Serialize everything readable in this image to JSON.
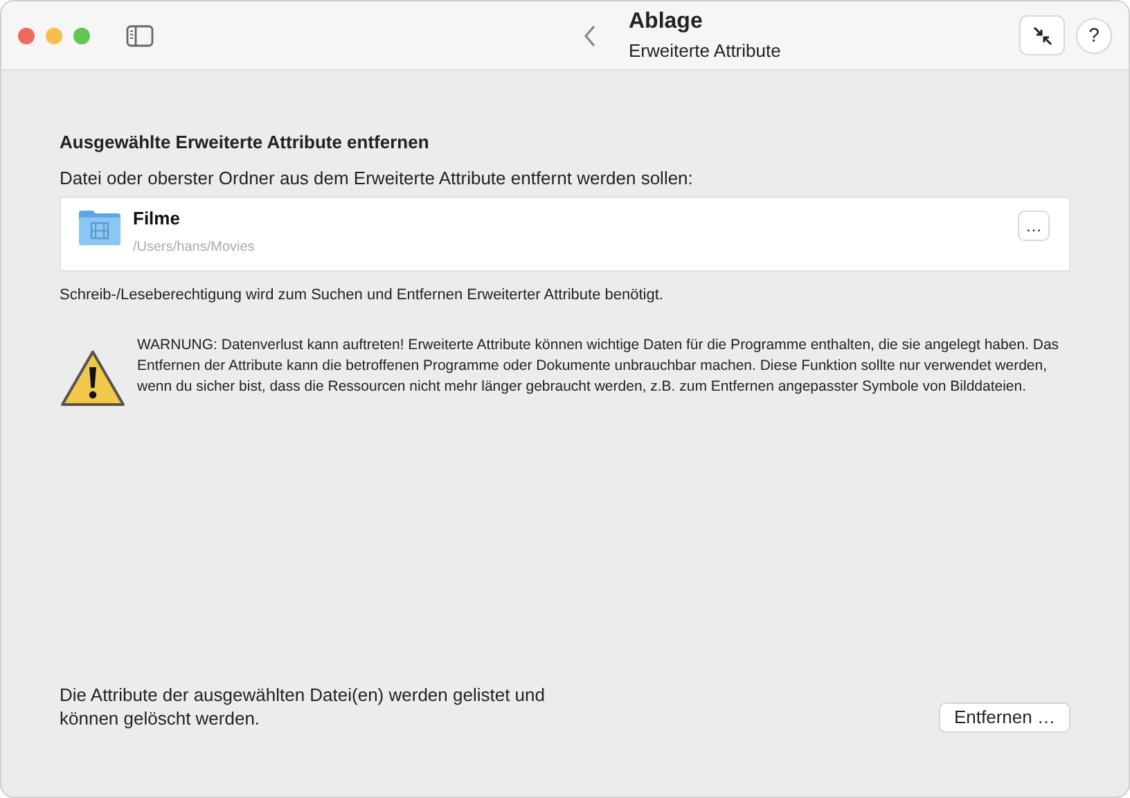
{
  "window": {
    "title": "Ablage",
    "subtitle": "Erweiterte Attribute"
  },
  "section_title": "Ausgewählte Erweiterte Attribute entfernen",
  "prompt": "Datei oder oberster Ordner aus dem Erweiterte Attribute entfernt werden sollen:",
  "selected_item": {
    "name": "Filme",
    "path": "/Users/hans/Movies",
    "browse_button": "…"
  },
  "permission_note": "Schreib-/Leseberechtigung wird zum Suchen und Entfernen Erweiterter Attribute benötigt.",
  "warning": "WARNUNG: Datenverlust kann auftreten! Erweiterte Attribute können wichtige Daten für die Programme enthalten, die sie angelegt haben. Das Entfernen der Attribute kann die betroffenen Programme oder Dokumente unbrauchbar machen. Diese Funktion sollte nur verwendet werden, wenn du sicher bist, dass die Ressourcen nicht mehr länger gebraucht werden, z.B. zum Entfernen angepasster Symbole von Bilddateien.",
  "footer_note": "Die Attribute der ausgewählten Datei(en) werden gelistet und können gelöscht werden.",
  "remove_button": "Entfernen …",
  "help_button": "?"
}
